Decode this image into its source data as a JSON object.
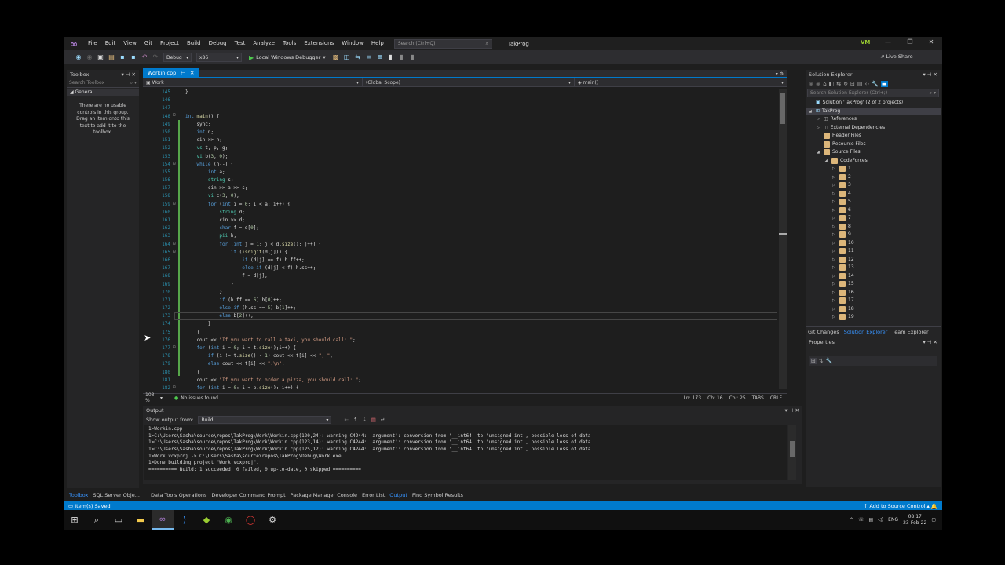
{
  "app": {
    "menu": [
      "File",
      "Edit",
      "View",
      "Git",
      "Project",
      "Build",
      "Debug",
      "Test",
      "Analyze",
      "Tools",
      "Extensions",
      "Window",
      "Help"
    ],
    "search_placeholder": "Search (Ctrl+Q)",
    "project_title": "TakProg",
    "avatar": "VM",
    "live_share": "Live Share"
  },
  "toolbar": {
    "config": "Debug",
    "platform": "x86",
    "run_label": "Local Windows Debugger"
  },
  "toolbox": {
    "title": "Toolbox",
    "search_placeholder": "Search Toolbox",
    "group": "General",
    "empty_text": "There are no usable controls in this group. Drag an item onto this text to add it to the toolbox."
  },
  "editor": {
    "tab_name": "Workin.cpp",
    "nav_project": "Work",
    "nav_scope": "(Global Scope)",
    "nav_member": "main()",
    "zoom": "103 %",
    "issues": "No issues found",
    "line": "Ln: 173",
    "char": "Ch: 16",
    "col": "Col: 25",
    "tabs": "TABS",
    "eol": "CRLF",
    "line_numbers": [
      "145",
      "146",
      "147",
      "148",
      "149",
      "150",
      "151",
      "152",
      "153",
      "154",
      "155",
      "156",
      "157",
      "158",
      "159",
      "160",
      "161",
      "162",
      "163",
      "164",
      "165",
      "166",
      "167",
      "168",
      "169",
      "170",
      "171",
      "172",
      "173",
      "174",
      "175",
      "176",
      "177",
      "178",
      "179",
      "180",
      "181",
      "182"
    ]
  },
  "output": {
    "title": "Output",
    "show_label": "Show output from:",
    "source": "Build",
    "lines": [
      "1>Workin.cpp",
      "1>C:\\Users\\Sasha\\source\\repos\\TakProg\\Work\\Workin.cpp(120,24): warning C4244: 'argument': conversion from '__int64' to 'unsigned int', possible loss of data",
      "1>C:\\Users\\Sasha\\source\\repos\\TakProg\\Work\\Workin.cpp(123,14): warning C4244: 'argument': conversion from '__int64' to 'unsigned int', possible loss of data",
      "1>C:\\Users\\Sasha\\source\\repos\\TakProg\\Work\\Workin.cpp(125,12): warning C4244: 'argument': conversion from '__int64' to 'unsigned int', possible loss of data",
      "1>Work.vcxproj -> C:\\Users\\Sasha\\source\\repos\\TakProg\\Debug\\Work.exe",
      "1>Done building project \"Work.vcxproj\".",
      "========== Build: 1 succeeded, 0 failed, 0 up-to-date, 0 skipped =========="
    ]
  },
  "bottom_tabs": [
    "Toolbox",
    "SQL Server Obje...",
    "Data Tools Operations",
    "Developer Command Prompt",
    "Package Manager Console",
    "Error List",
    "Output",
    "Find Symbol Results"
  ],
  "solution_explorer": {
    "title": "Solution Explorer",
    "search_placeholder": "Search Solution Explorer (Ctrl+;)",
    "solution": "Solution 'TakProg' (2 of 2 projects)",
    "project": "TakProg",
    "items": [
      "References",
      "External Dependencies",
      "Header Files",
      "Resource Files",
      "Source Files"
    ],
    "folder": "CodeForces",
    "subfolders": [
      "1",
      "2",
      "3",
      "4",
      "5",
      "6",
      "7",
      "8",
      "9",
      "10",
      "11",
      "12",
      "13",
      "14",
      "15",
      "16",
      "17",
      "18",
      "19"
    ],
    "tabs": [
      "Git Changes",
      "Solution Explorer",
      "Team Explorer"
    ]
  },
  "properties": {
    "title": "Properties"
  },
  "status": {
    "left": "Item(s) Saved",
    "right": "Add to Source Control"
  },
  "taskbar": {
    "lang": "ENG",
    "time": "08:17",
    "date": "23-Feb-22"
  }
}
